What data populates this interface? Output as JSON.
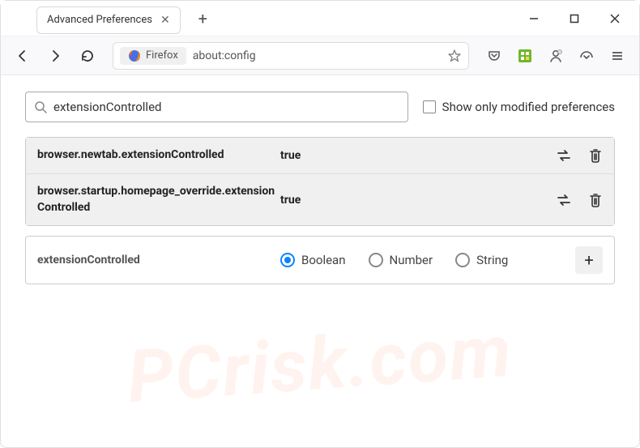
{
  "window": {
    "tab_title": "Advanced Preferences"
  },
  "toolbar": {
    "firefox_label": "Firefox",
    "url": "about:config"
  },
  "search": {
    "value": "extensionControlled",
    "checkbox_label": "Show only modified preferences"
  },
  "prefs": [
    {
      "name": "browser.newtab.extensionControlled",
      "value": "true"
    },
    {
      "name": "browser.startup.homepage_override.extensionControlled",
      "value": "true"
    }
  ],
  "new_pref": {
    "name": "extensionControlled",
    "types": [
      "Boolean",
      "Number",
      "String"
    ],
    "selected": "Boolean"
  },
  "watermark": "PCrisk.com"
}
